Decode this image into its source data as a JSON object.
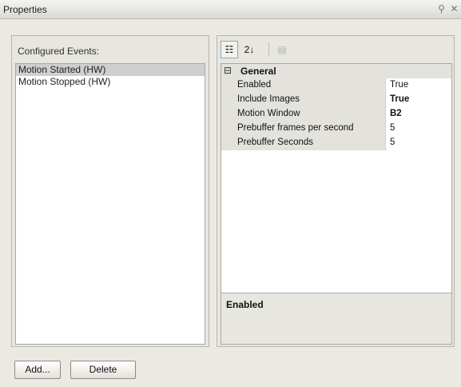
{
  "window": {
    "title": "Properties",
    "pin_glyph": "⚲",
    "close_glyph": "✕"
  },
  "left_panel": {
    "label": "Configured Events:",
    "events": [
      {
        "label": "Motion Started (HW)",
        "selected": true
      },
      {
        "label": "Motion Stopped (HW)",
        "selected": false
      }
    ]
  },
  "toolbar": {
    "categorized_glyph": "☷",
    "alphabetical_glyph": "2↓",
    "property_pages_glyph": "▤"
  },
  "property_grid": {
    "category": {
      "toggle": "⊟",
      "name": "General"
    },
    "properties": [
      {
        "name": "Enabled",
        "value": "True",
        "bold": false
      },
      {
        "name": "Include Images",
        "value": "True",
        "bold": true
      },
      {
        "name": "Motion Window",
        "value": "B2",
        "bold": true
      },
      {
        "name": "Prebuffer frames per second",
        "value": "5",
        "bold": false
      },
      {
        "name": "Prebuffer Seconds",
        "value": "5",
        "bold": false
      }
    ]
  },
  "description": {
    "title": "Enabled"
  },
  "buttons": {
    "add": "Add...",
    "delete": "Delete"
  },
  "icons": {
    "window_pin": "pin-icon",
    "window_close": "close-icon",
    "categorized": "categorized-icon",
    "alphabetical": "sort-alphabetical-icon",
    "property_pages": "property-pages-icon",
    "category_toggle": "collapse-icon"
  },
  "colors": {
    "background": "#ebe9e2",
    "selection": "#cfcfcf",
    "grid_gutter": "#e3e2dc"
  }
}
